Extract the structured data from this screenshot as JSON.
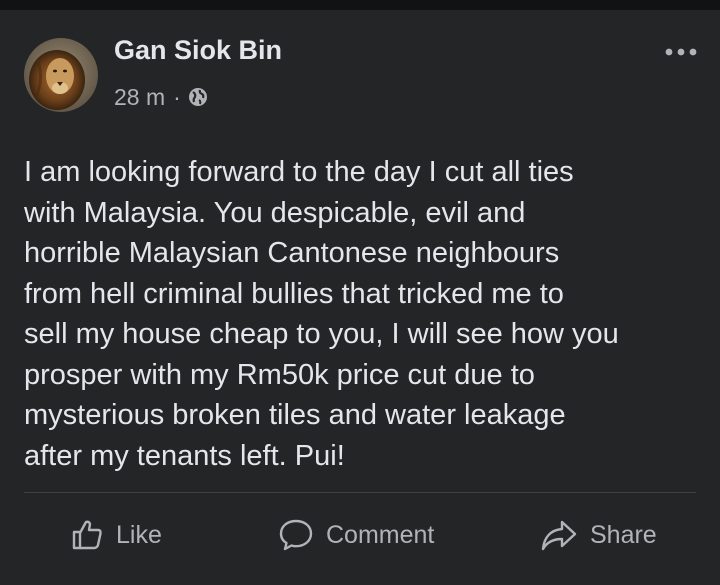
{
  "post": {
    "author": "Gan Siok Bin",
    "time": "28 m",
    "separator": "·",
    "privacy_icon": "globe-icon",
    "more_icon": "more-options-icon",
    "text_lines": [
      "I am looking forward to the day I cut all ties",
      "with Malaysia. You despicable, evil and",
      "horrible Malaysian Cantonese neighbours",
      "from hell criminal bullies that tricked me to",
      "sell my house cheap to you, I will see how you",
      "prosper with my Rm50k price cut due to",
      "mysterious broken tiles and water leakage",
      "after my tenants left. Pui!"
    ]
  },
  "actions": {
    "like": {
      "label": "Like",
      "icon": "thumbs-up-icon"
    },
    "comment": {
      "label": "Comment",
      "icon": "speech-bubble-icon"
    },
    "share": {
      "label": "Share",
      "icon": "share-arrow-icon"
    }
  },
  "colors": {
    "background": "#18191a",
    "card": "#242526",
    "primary_text": "#e4e6eb",
    "secondary_text": "#b0b3b8",
    "divider": "#3e4042"
  }
}
